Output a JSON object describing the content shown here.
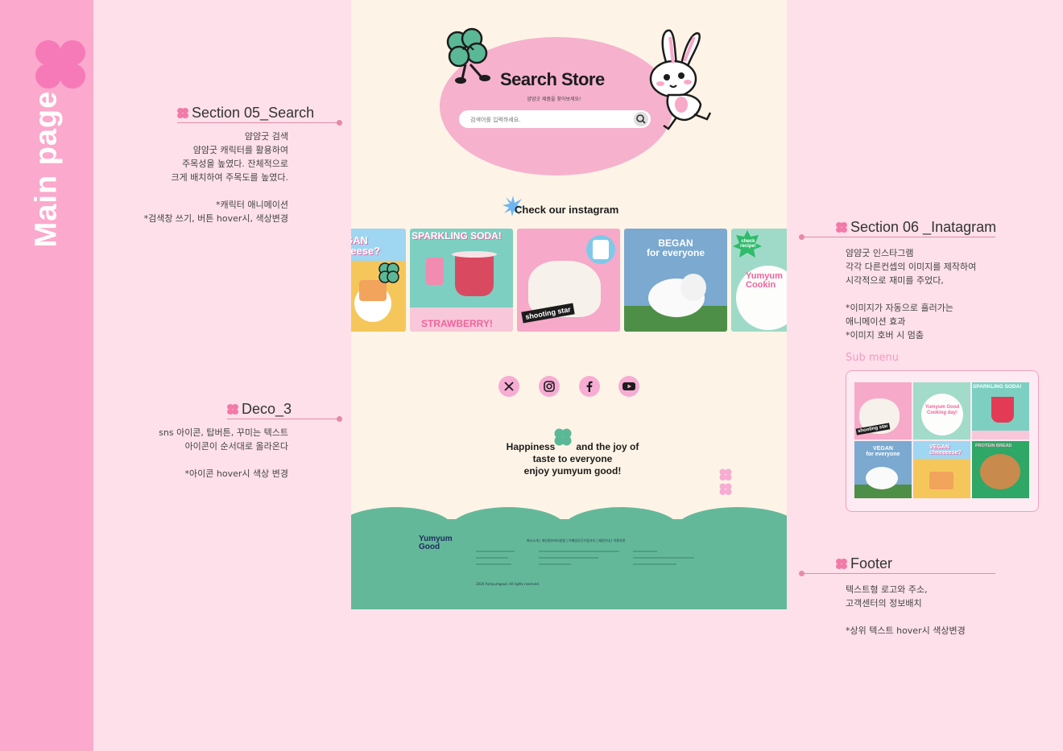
{
  "sidebar": {
    "title": "Main page"
  },
  "notes": {
    "search": {
      "title": "Section 05_Search",
      "body": "얌얌굿 검색\n얌얌굿 캐릭터를 활용하여\n주목성을 높였다.  잔체적으로\n크게 배치하여  주목도를 높였다.\n\n*캐릭터 애니메이션\n*검색창 쓰기, 버튼 hover시, 색상변경"
    },
    "deco": {
      "title": "Deco_3",
      "body": "sns 아이콘, 탑버튼,  꾸미는 텍스트\n아이콘이 순서대로 올라온다\n\n*아이콘 hover시 색상 변경"
    },
    "instagram": {
      "title": "Section 06 _Inatagram",
      "body": "얌얌굿 인스타그램\n각각 다른컨셉의 이미지를 제작하여\n시각적으로 재미를 주었다,\n\n*이미지가 자동으로 흘러가는\n애니메이션 효과\n*이미지 호버 시 멈춤"
    },
    "footer": {
      "title": "Footer",
      "body": "텍스트형 로고와 주소,\n고객센터의 정보배치\n\n*상위 텍스트 hover시 색상변경"
    },
    "submenu_label": "Sub menu"
  },
  "mockup": {
    "search": {
      "title": "Search Store",
      "subtitle": "얌얌굿 제품을 찾아보세요!",
      "placeholder": "검색어를 입력하세요."
    },
    "instagram_title": "Check our instagram",
    "cards": [
      {
        "caption": "GAN\neeese?"
      },
      {
        "caption": "SPARKLING SODA!",
        "caption2": "STRAWBERRY!"
      },
      {
        "caption": "shooting star"
      },
      {
        "caption": "BEGAN\nfor everyone"
      },
      {
        "caption": "check recipe!",
        "caption2": "Yumyum\nCookin"
      }
    ],
    "sns": [
      "x-icon",
      "instagram-icon",
      "facebook-icon",
      "youtube-icon"
    ],
    "tagline": {
      "part1": "Happiness",
      "part2": "and the joy of",
      "line2": "taste to everyone",
      "line3": "enjoy yumyum good!"
    },
    "footer": {
      "logo_line1": "Yumyum",
      "logo_line2": "Good",
      "links": "회사소개 | 개인정보처리방침 | 이메일무단수집거부 | 제휴안내 | 이용약관",
      "copyright": "2024 Yumyumgood. All rights reserved."
    }
  },
  "submenu": {
    "tiles": [
      {
        "caption": "shooting star"
      },
      {
        "caption": "Yumyum Good\nCooking day!"
      },
      {
        "caption": "SPARKLING SODA!"
      },
      {
        "caption": "VEGAN\nfor everyone"
      },
      {
        "caption": "VEGAN\ncheeeeese?"
      },
      {
        "caption": "PROTEIN BREAD"
      }
    ]
  }
}
